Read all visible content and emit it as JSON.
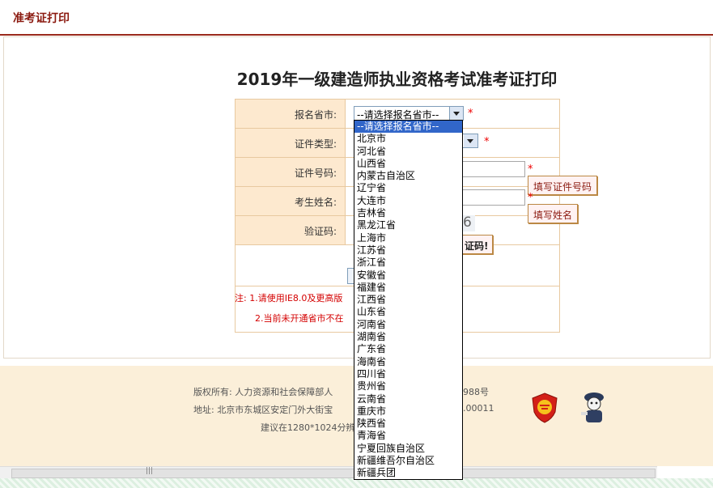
{
  "header": {
    "title": "准考证打印"
  },
  "page_title": "2019年一级建造师执业资格考试准考证打印",
  "form": {
    "province_label": "报名省市:",
    "province_selected": "--请选择报名省市--",
    "id_type_label": "证件类型:",
    "id_number_label": "证件号码:",
    "name_label": "考生姓名:",
    "captcha_label": "验证码:",
    "required_mark": "*",
    "captcha_digit": "6",
    "tip_id": "填写证件号码",
    "tip_name": "填写姓名",
    "tip_captcha": "证码!"
  },
  "notes": {
    "note1": "注: 1.请使用IE8.0及更高版",
    "note2": "2.当前未开通省市不在"
  },
  "dropdown": {
    "options": [
      "--请选择报名省市--",
      "北京市",
      "河北省",
      "山西省",
      "内蒙古自治区",
      "辽宁省",
      "大连市",
      "吉林省",
      "黑龙江省",
      "上海市",
      "江苏省",
      "浙江省",
      "安徽省",
      "福建省",
      "江西省",
      "山东省",
      "河南省",
      "湖南省",
      "广东省",
      "海南省",
      "四川省",
      "贵州省",
      "云南省",
      "重庆市",
      "陕西省",
      "青海省",
      "宁夏回族自治区",
      "新疆维吾尔自治区",
      "新疆兵团"
    ]
  },
  "footer": {
    "copyright": "版权所有: 人力资源和社会保障部人",
    "icp": "988号",
    "address": "地址: 北京市东城区安定门外大街宝",
    "code": ".00011",
    "resolution": "建议在1280*1024分辨"
  },
  "icons": {
    "emblem": "shield-emblem-icon",
    "police": "police-icon"
  },
  "colors": {
    "accent": "#8b1a10",
    "selection": "#3166c9"
  }
}
